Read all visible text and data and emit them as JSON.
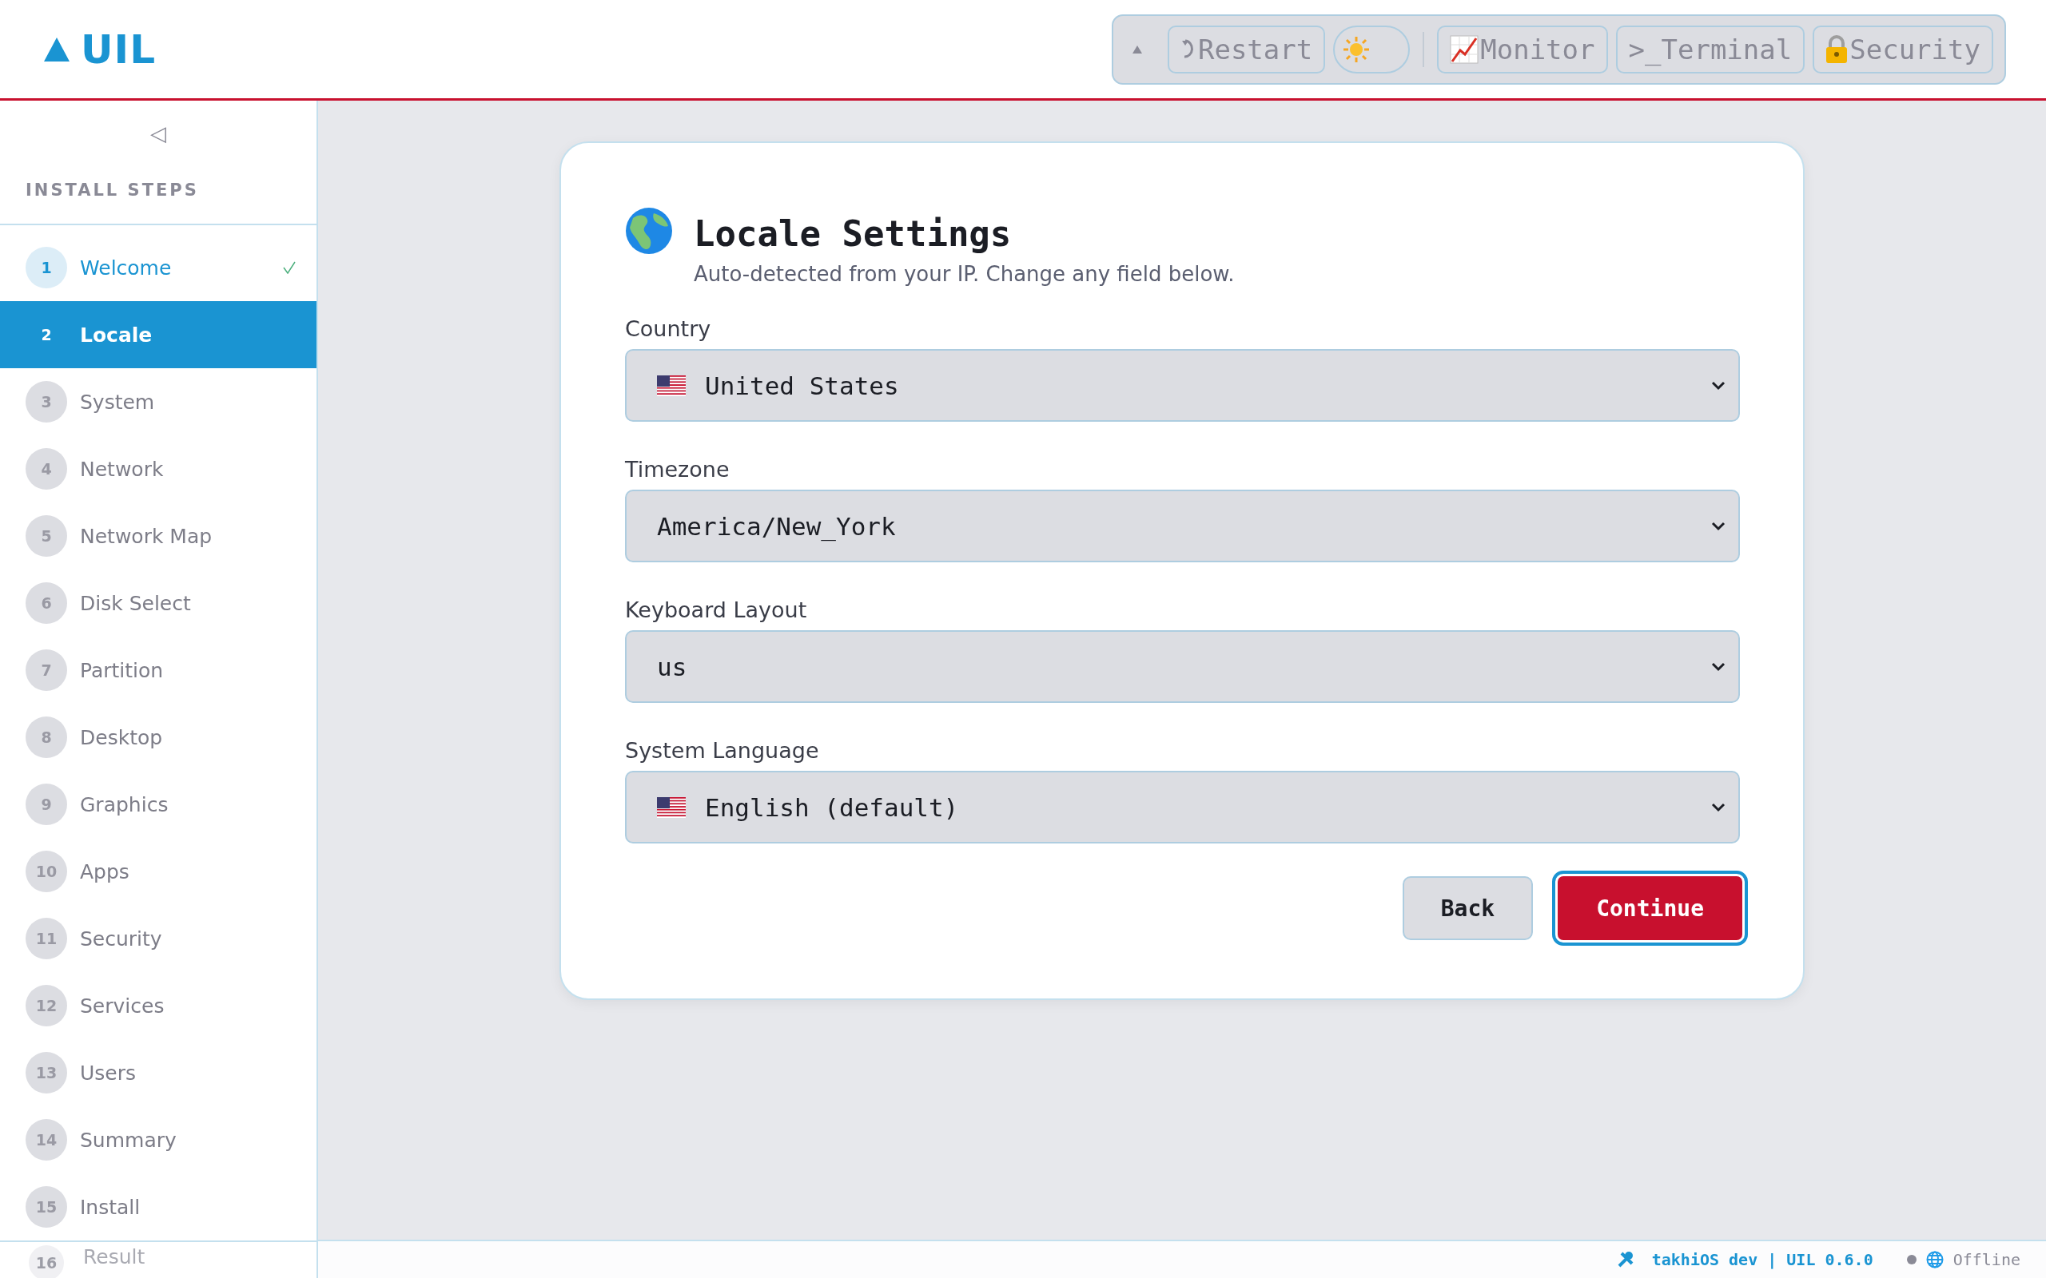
{
  "header": {
    "logo": "UIL",
    "toolbar": {
      "items": [
        {
          "kind": "caret"
        },
        {
          "kind": "restart",
          "label": "Restart"
        },
        {
          "kind": "toggle",
          "on": true
        },
        {
          "kind": "separator"
        },
        {
          "kind": "monitor",
          "label": "Monitor"
        },
        {
          "kind": "plain",
          "label": ">_Terminal"
        },
        {
          "kind": "security",
          "label": "Security"
        }
      ]
    }
  },
  "sidebar": {
    "collapse": "◁",
    "title": "INSTALL STEPS",
    "steps": [
      {
        "number": "1",
        "label": "Welcome",
        "selected": false,
        "completed": true
      },
      {
        "number": "2",
        "label": "Locale",
        "selected": true,
        "completed": false
      },
      {
        "number": "3",
        "label": "System",
        "selected": false,
        "completed": false
      },
      {
        "number": "4",
        "label": "Network",
        "selected": false,
        "completed": false
      },
      {
        "number": "5",
        "label": "Network Map",
        "selected": false,
        "completed": false
      },
      {
        "number": "6",
        "label": "Disk Select",
        "selected": false,
        "completed": false
      },
      {
        "number": "7",
        "label": "Partition",
        "selected": false,
        "completed": false
      },
      {
        "number": "8",
        "label": "Desktop",
        "selected": false,
        "completed": false
      },
      {
        "number": "9",
        "label": "Graphics",
        "selected": false,
        "completed": false
      },
      {
        "number": "10",
        "label": "Apps",
        "selected": false,
        "completed": false
      },
      {
        "number": "11",
        "label": "Security",
        "selected": false,
        "completed": false
      },
      {
        "number": "12",
        "label": "Services",
        "selected": false,
        "completed": false
      },
      {
        "number": "13",
        "label": "Users",
        "selected": false,
        "completed": false
      },
      {
        "number": "14",
        "label": "Summary",
        "selected": false,
        "completed": false
      },
      {
        "number": "15",
        "label": "Install",
        "selected": false,
        "completed": false
      },
      {
        "number": "16",
        "label": "Result",
        "selected": false,
        "completed": false
      }
    ]
  },
  "card": {
    "title": "Locale Settings",
    "subtitle": "Auto-detected from your IP. Change any field below.",
    "fields": [
      {
        "kind": "flagged",
        "label": "Country",
        "value": "United States"
      },
      {
        "kind": "plain",
        "label": "Timezone",
        "value": "America/New_York"
      },
      {
        "kind": "plain",
        "label": "Keyboard Layout",
        "value": "us"
      },
      {
        "kind": "flagged",
        "label": "System Language",
        "value": "English (default)"
      }
    ],
    "buttons": [
      {
        "kind": "secondary",
        "label": "Back"
      },
      {
        "kind": "primary",
        "label": "Continue"
      }
    ]
  },
  "status_bar": {
    "build": "takhiOS dev | UIL 0.6.0",
    "online": false,
    "connection": "Offline"
  }
}
